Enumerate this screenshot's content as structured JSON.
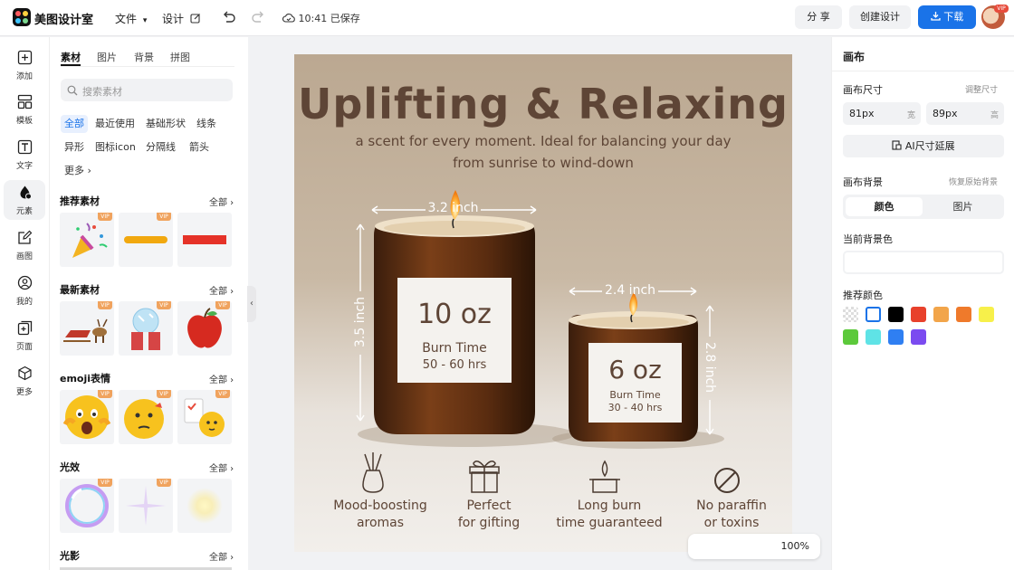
{
  "app": {
    "name": "美图设计室"
  },
  "toolbar": {
    "file_menu": "文件",
    "design_menu": "设计",
    "saved_status": "10:41 已保存",
    "share_label": "分 享",
    "create_design_label": "创建设计",
    "download_label": "下载",
    "avatar_badge": "VIP"
  },
  "sidebar": {
    "items": [
      {
        "label": "添加",
        "icon": "plus-square-icon"
      },
      {
        "label": "模板",
        "icon": "template-icon"
      },
      {
        "label": "文字",
        "icon": "text-icon"
      },
      {
        "label": "元素",
        "icon": "shapes-icon"
      },
      {
        "label": "画图",
        "icon": "draw-icon"
      },
      {
        "label": "我的",
        "icon": "user-icon"
      },
      {
        "label": "页面",
        "icon": "page-add-icon"
      },
      {
        "label": "更多",
        "icon": "cube-icon"
      }
    ],
    "active_index": 3
  },
  "assets": {
    "tabs": [
      "素材",
      "图片",
      "背景",
      "拼图"
    ],
    "active_tab": 0,
    "search_placeholder": "搜索素材",
    "chips": [
      "全部",
      "最近使用",
      "基础形状",
      "线条",
      "异形",
      "图标icon",
      "分隔线",
      "箭头",
      "更多"
    ],
    "vip_badge": "VIP",
    "sections": [
      {
        "title": "推荐素材",
        "all_label": "全部"
      },
      {
        "title": "最新素材",
        "all_label": "全部"
      },
      {
        "title": "emoji表情",
        "all_label": "全部"
      },
      {
        "title": "光效",
        "all_label": "全部"
      },
      {
        "title": "光影",
        "all_label": "全部"
      }
    ]
  },
  "design": {
    "title": "Uplifting & Relaxing",
    "subtitle_line1": "a scent for every moment. Ideal for balancing your day",
    "subtitle_line2": "from sunrise to wind-down",
    "large_candle": {
      "width_label": "3.2 inch",
      "height_label": "3.5 inch",
      "weight": "10 oz",
      "burn_label": "Burn Time",
      "burn_hours": "50 - 60 hrs"
    },
    "small_candle": {
      "width_label": "2.4 inch",
      "height_label": "2.8 inch",
      "weight": "6 oz",
      "burn_label": "Burn Time",
      "burn_hours": "30 - 40 hrs"
    },
    "features": [
      {
        "line1": "Mood-boosting",
        "line2": "aromas",
        "icon": "reed-diffuser-icon"
      },
      {
        "line1": "Perfect",
        "line2": "for gifting",
        "icon": "gift-icon"
      },
      {
        "line1": "Long burn",
        "line2": "time guaranteed",
        "icon": "candle-icon"
      },
      {
        "line1": "No paraffin",
        "line2": "or toxins",
        "icon": "prohibited-icon"
      }
    ]
  },
  "zoom": {
    "level": "100%"
  },
  "inspector": {
    "header": "画布",
    "size_title": "画布尺寸",
    "adjust_size_label": "调整尺寸",
    "width_value": "81px",
    "width_unit": "宽",
    "height_value": "89px",
    "height_unit": "高",
    "ai_extend_label": "AI尺寸延展",
    "background_title": "画布背景",
    "restore_label": "恢复原始背景",
    "bg_tabs": [
      "颜色",
      "图片"
    ],
    "bg_active_tab": 0,
    "current_bg_title": "当前背景色",
    "recommended_title": "推荐颜色",
    "colors": [
      "transparent",
      "#ffffff",
      "#000000",
      "#e8412c",
      "#f2a54a",
      "#ef7a2b",
      "#f7f04a",
      "#5cc93b",
      "#5fe3e6",
      "#2f7ff2",
      "#7b4bf0"
    ],
    "accent_color": "#1a73e8"
  }
}
